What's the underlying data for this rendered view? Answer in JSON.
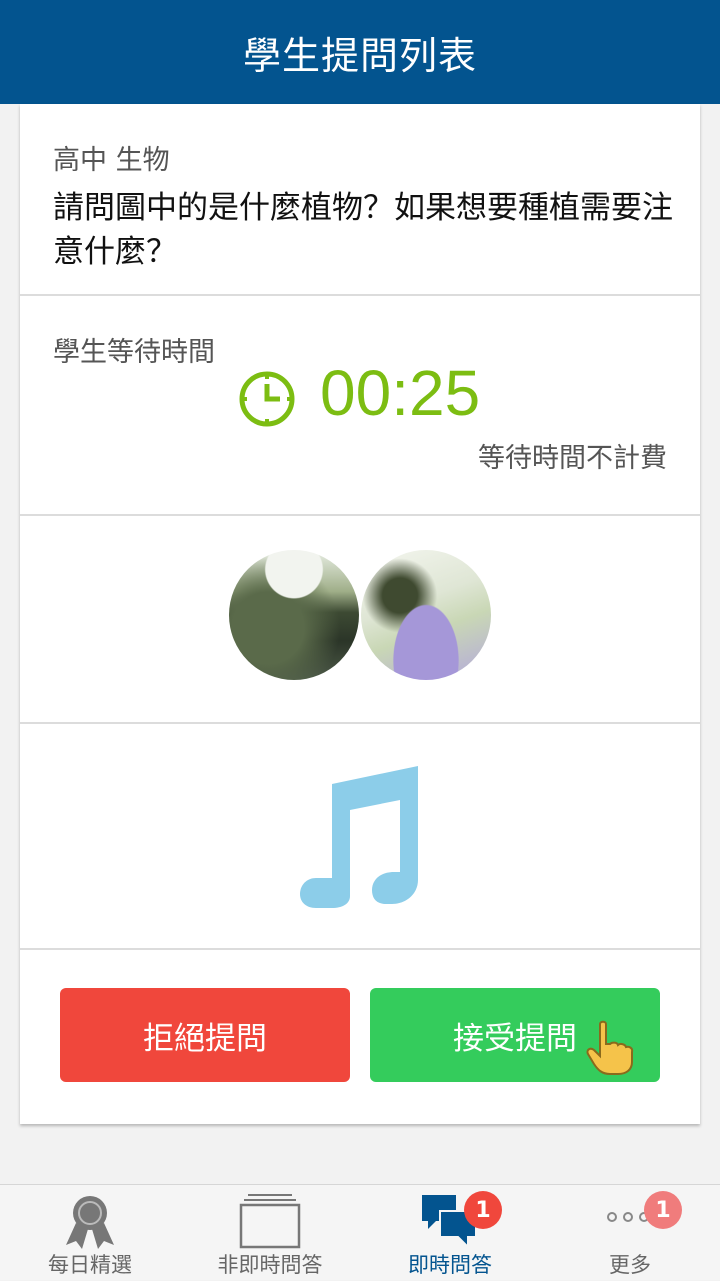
{
  "header": {
    "title": "學生提問列表"
  },
  "question": {
    "subject": "高中 生物",
    "text": "請問圖中的是什麼植物？如果想要種植需要注意什麼？"
  },
  "wait": {
    "label": "學生等待時間",
    "timer": "00:25",
    "note": "等待時間不計費",
    "timer_color": "#7cbd12"
  },
  "attachments": {
    "images": [
      "photo-moss-wall",
      "photo-purple-flower"
    ],
    "audio_icon": "music-note-icon"
  },
  "actions": {
    "reject_label": "拒絕提問",
    "accept_label": "接受提問",
    "reject_color": "#f0473c",
    "accept_color": "#34cc5c"
  },
  "tabs": [
    {
      "label": "每日精選",
      "icon": "ribbon-award-icon"
    },
    {
      "label": "非即時問答",
      "icon": "stacked-cards-icon"
    },
    {
      "label": "即時問答",
      "icon": "chat-bubbles-icon",
      "badge": "1",
      "active": true
    },
    {
      "label": "更多",
      "icon": "more-dots-icon",
      "badge": "1"
    }
  ],
  "colors": {
    "header_bg": "#03548f",
    "accent": "#03548f"
  }
}
